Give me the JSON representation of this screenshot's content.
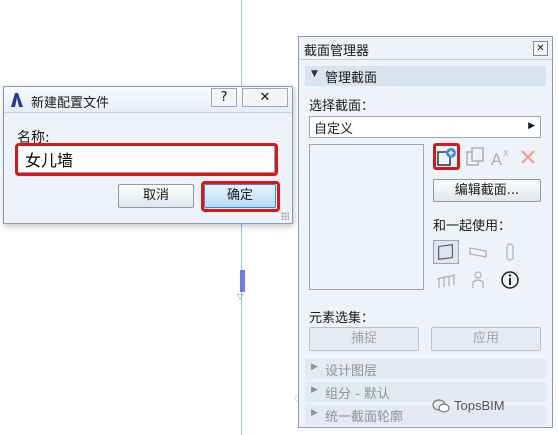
{
  "new_config_dialog": {
    "title": "新建配置文件",
    "help_glyph": "?",
    "close_glyph": "✕",
    "name_label": "名称:",
    "name_value": "女儿墙",
    "cancel_label": "取消",
    "ok_label": "确定"
  },
  "section_manager": {
    "title": "截面管理器",
    "close_glyph": "✕",
    "manage_header": "管理截面",
    "select_label": "选择截面：",
    "selected_section": "自定义",
    "edit_button": "编辑截面...",
    "use_with_label": "和一起使用：",
    "element_set_label": "元素选集：",
    "capture_button": "捕捉",
    "apply_button": "应用",
    "collapsed_sections": [
      "设计图层",
      "组分 - 默认",
      "统一截面轮廓"
    ],
    "icons": [
      "new-section-icon",
      "duplicate-icon",
      "rename-icon",
      "delete-icon",
      "wall-icon",
      "beam-icon",
      "column-icon",
      "railing-icon",
      "object-icon",
      "info-icon"
    ]
  },
  "watermark": "TopsBIM",
  "colors": {
    "highlight": "#e01414",
    "accent": "#2f8bd8",
    "panel_bg": "#eef3fa"
  }
}
